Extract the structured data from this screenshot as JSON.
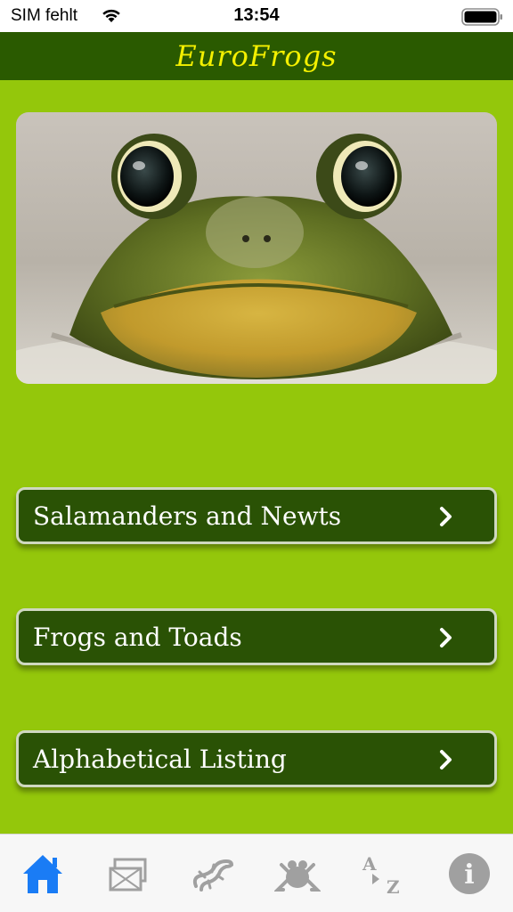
{
  "status_bar": {
    "carrier": "SIM fehlt",
    "time": "13:54"
  },
  "nav_bar": {
    "title": "EuroFrogs"
  },
  "menu": {
    "items": [
      {
        "label": "Salamanders and Newts"
      },
      {
        "label": "Frogs and Toads"
      },
      {
        "label": "Alphabetical Listing"
      }
    ]
  },
  "tab_bar": {
    "tabs": [
      {
        "icon": "home-icon",
        "selected": true
      },
      {
        "icon": "map-icon",
        "selected": false
      },
      {
        "icon": "salamander-icon",
        "selected": false
      },
      {
        "icon": "frog-icon",
        "selected": false
      },
      {
        "icon": "a-to-z-icon",
        "selected": false
      },
      {
        "icon": "info-icon",
        "selected": false
      }
    ],
    "az_letters": {
      "top": "A",
      "bottom": "Z"
    },
    "info_glyph": "i"
  },
  "colors": {
    "background": "#94c70b",
    "nav_bar": "#2a5a00",
    "title": "#f4f000",
    "button": "#2a5205",
    "tab_selected": "#1a7cf5",
    "tab_unselected": "#a0a0a0"
  }
}
